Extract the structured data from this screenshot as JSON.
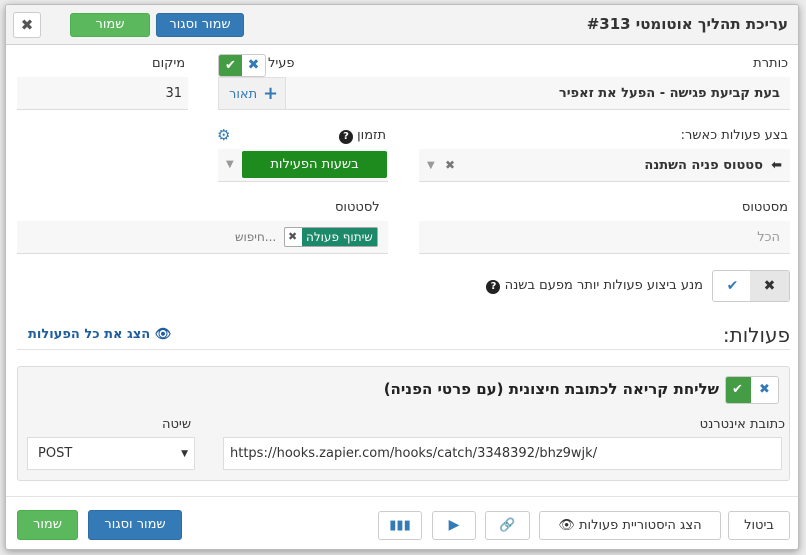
{
  "header": {
    "title": "עריכת תהליך אוטומטי #313",
    "save_close": "שמור וסגור",
    "save": "שמור",
    "close": "✖"
  },
  "form": {
    "title_label": "כותרת",
    "title_value": "בעת קביעת פגישה - הפעל את זאפיר",
    "active_label": "פעיל",
    "location_label": "מיקום",
    "location_value": "31",
    "description_btn": "תאור",
    "trigger_label": "בצע פעולות כאשר:",
    "trigger_value": "סטטוס פניה השתנה",
    "timing_label": "תזמון",
    "timing_value": "בשעות הפעילות",
    "from_status_label": "מסטטוס",
    "from_status_placeholder": "הכל",
    "to_status_label": "לסטטוס",
    "to_status_tag": "שיתוף פעולה",
    "to_status_search": "חיפוש...",
    "prevent_label": "מנע ביצוע פעולות יותר מפעם בשנה"
  },
  "actions": {
    "title": "פעולות:",
    "show_all": "הצג את כל הפעולות",
    "item": {
      "title": "שליחת קריאה לכתובת חיצונית (עם פרטי הפניה)",
      "url_label": "כתובת אינטרנט",
      "url_value": "https://hooks.zapier.com/hooks/catch/3348392/bhz9wjk/",
      "method_label": "שיטה",
      "method_value": "POST"
    }
  },
  "footer": {
    "cancel": "ביטול",
    "history": "הצג היסטוריית פעולות",
    "save_close": "שמור וסגור",
    "save": "שמור"
  },
  "colors": {
    "primary": "#337ab7",
    "success": "#5cb85c",
    "dark_green": "#449d44",
    "tag": "#1c8a6a"
  }
}
